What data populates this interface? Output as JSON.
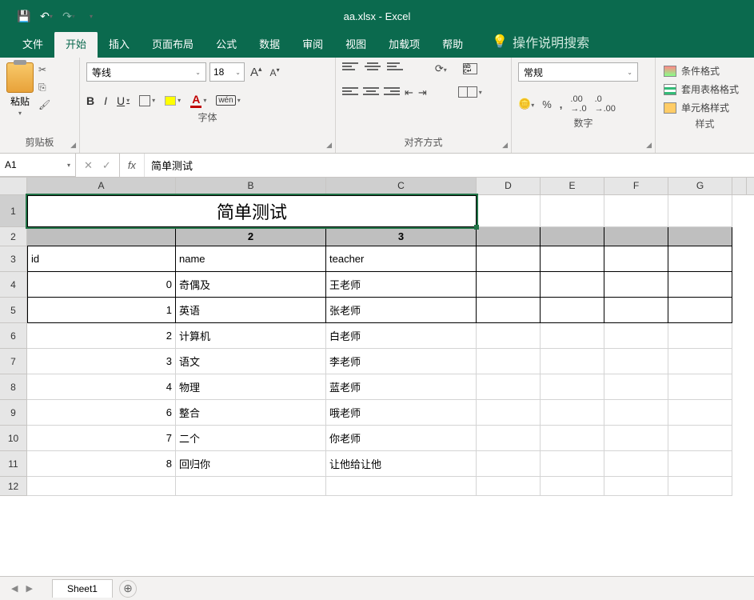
{
  "title": "aa.xlsx - Excel",
  "menu": {
    "items": [
      "文件",
      "开始",
      "插入",
      "页面布局",
      "公式",
      "数据",
      "审阅",
      "视图",
      "加载项",
      "帮助"
    ],
    "active": 1,
    "tellme": "操作说明搜索"
  },
  "ribbon": {
    "clipboard": {
      "paste": "粘贴",
      "label": "剪贴板"
    },
    "font": {
      "name": "等线",
      "size": "18",
      "label": "字体"
    },
    "alignment": {
      "label": "对齐方式"
    },
    "number": {
      "format": "常规",
      "label": "数字"
    },
    "styles": {
      "label": "样式",
      "cond": "条件格式",
      "table": "套用表格格式",
      "cell": "单元格样式"
    }
  },
  "formula_bar": {
    "cell_ref": "A1",
    "fx": "fx",
    "value": "简单测试"
  },
  "grid": {
    "col_widths": {
      "A": 186,
      "B": 188,
      "C": 188,
      "other": 80
    },
    "row_heights": {
      "1": 40,
      "2": 24,
      "other": 32,
      "plain": 24
    },
    "columns": [
      "A",
      "B",
      "C",
      "D",
      "E",
      "F",
      "G"
    ],
    "merged_title": "简单测试",
    "header_row": [
      "",
      "2",
      "3"
    ],
    "rows": [
      [
        "id",
        "name",
        "teacher"
      ],
      [
        "0",
        "奇偶及",
        "王老师"
      ],
      [
        "1",
        "英语",
        "张老师"
      ],
      [
        "2",
        "计算机",
        "白老师"
      ],
      [
        "3",
        "语文",
        "李老师"
      ],
      [
        "4",
        "物理",
        "蓝老师"
      ],
      [
        "6",
        "整合",
        "哦老师"
      ],
      [
        "7",
        "二个",
        "你老师"
      ],
      [
        "8",
        "回归你",
        "让他给让他"
      ]
    ]
  },
  "sheet": {
    "name": "Sheet1"
  }
}
